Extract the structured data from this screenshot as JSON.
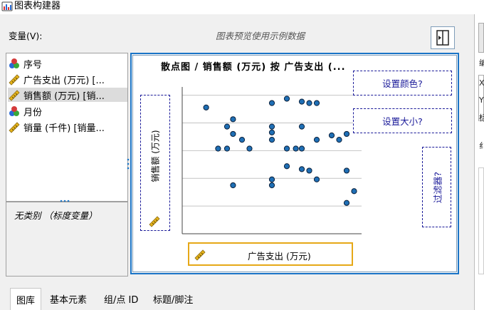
{
  "window": {
    "title": "图表构建器"
  },
  "variables_label": "变量(V):",
  "preview_note": "图表预览使用示例数据",
  "variables": [
    {
      "label": "序号",
      "icon": "nominal-icon",
      "selected": false
    },
    {
      "label": "广告支出 (万元) [...",
      "icon": "scale-icon",
      "selected": false
    },
    {
      "label": "销售额 (万元) [销...",
      "icon": "scale-icon",
      "selected": true
    },
    {
      "label": "月份",
      "icon": "nominal-icon",
      "selected": false
    },
    {
      "label": "销量 (千件) [销量...",
      "icon": "scale-icon",
      "selected": false
    }
  ],
  "categories_text": "无类别 （标度变量）",
  "canvas": {
    "title": "散点图 / 销售额 (万元) 按 广告支出 (...",
    "set_color": "设置颜色?",
    "set_size": "设置大小?",
    "filter": "过滤器?",
    "y_field": "销售额 (万元)",
    "x_field": "广告支出 (万元)"
  },
  "tabs": [
    {
      "label": "图库",
      "active": true
    },
    {
      "label": "基本元素",
      "active": false
    },
    {
      "label": "组/点 ID",
      "active": false
    },
    {
      "label": "标题/脚注",
      "active": false
    }
  ],
  "right_panel": {
    "chars": [
      "编",
      "X",
      "Y",
      "标",
      "纟"
    ]
  },
  "colors": {
    "accent": "#1a74c6",
    "point_fill": "#1f6fb5",
    "dropzone": "#1a1a99",
    "x_highlight": "#e6a817"
  },
  "chart_data": {
    "type": "scatter",
    "xlabel": "广告支出 (万元)",
    "ylabel": "销售额 (万元)",
    "grid": true,
    "xlim": [
      0,
      12
    ],
    "ylim": [
      0,
      10
    ],
    "points": [
      [
        7,
        9.2
      ],
      [
        8,
        9
      ],
      [
        6,
        8.9
      ],
      [
        8.5,
        8.9
      ],
      [
        9,
        8.9
      ],
      [
        1.6,
        8.6
      ],
      [
        3.4,
        7.8
      ],
      [
        3,
        7.3
      ],
      [
        3.4,
        6.8
      ],
      [
        6,
        7.3
      ],
      [
        8,
        7.3
      ],
      [
        10,
        6.7
      ],
      [
        6,
        6.9
      ],
      [
        4,
        6.4
      ],
      [
        6,
        6.4
      ],
      [
        9,
        6.4
      ],
      [
        10.5,
        6.4
      ],
      [
        11,
        6.8
      ],
      [
        2.4,
        5.8
      ],
      [
        3,
        5.8
      ],
      [
        4.5,
        5.8
      ],
      [
        7,
        5.8
      ],
      [
        7.6,
        5.8
      ],
      [
        8,
        5.8
      ],
      [
        8,
        4.4
      ],
      [
        7,
        4.6
      ],
      [
        8.5,
        4.3
      ],
      [
        11,
        4.3
      ],
      [
        3.4,
        3.3
      ],
      [
        6,
        3.3
      ],
      [
        6,
        3.7
      ],
      [
        9,
        3.7
      ],
      [
        11.5,
        2.9
      ],
      [
        11,
        2.1
      ]
    ]
  }
}
